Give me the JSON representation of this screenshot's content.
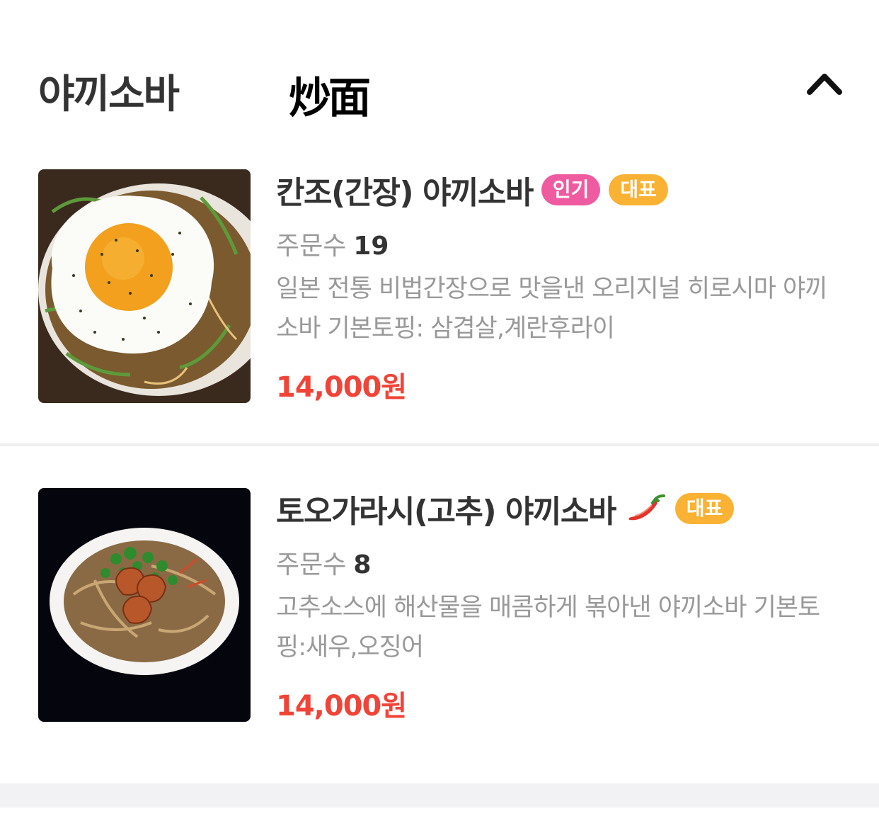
{
  "section": {
    "title": "야끼소바",
    "logo_text": "炒面",
    "toggle_icon": "chevron-up-icon"
  },
  "items": [
    {
      "name": "칸조(간장) 야끼소바",
      "badges": [
        "인기",
        "대표"
      ],
      "order_label": "주문수",
      "order_count": "19",
      "description": "일본 전통 비법간장으로 맛을낸 오리지널 히로시마 야끼소바 기본토핑: 삼겹살,계란후라이",
      "price": "14,000원",
      "image": "fried-egg-yakisoba-photo"
    },
    {
      "name": "토오가라시(고추) 야끼소바",
      "icons": [
        "chili-pepper-icon"
      ],
      "badges": [
        "대표"
      ],
      "order_label": "주문수",
      "order_count": "8",
      "description": "고추소스에 해산물을 매콤하게 볶아낸 야끼소바 기본토핑:새우,오징어",
      "price": "14,000원",
      "image": "shrimp-yakisoba-photo"
    }
  ],
  "colors": {
    "price": "#f04438",
    "badge_popular": "#ef5ba1",
    "badge_signature": "#f9b233",
    "muted_text": "#999999",
    "title_text": "#333333"
  }
}
